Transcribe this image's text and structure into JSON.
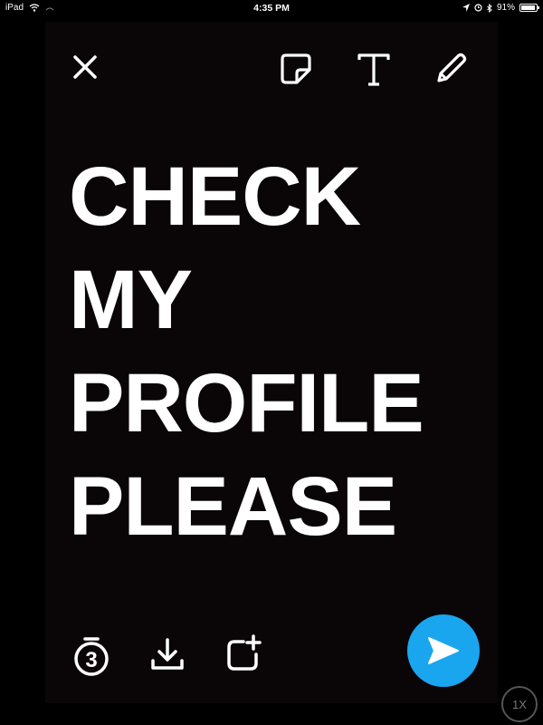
{
  "status_bar": {
    "device": "iPad",
    "time": "4:35 PM",
    "battery_text": "91%",
    "battery_level": 0.91,
    "icons": [
      "wifi-icon",
      "location-icon",
      "alarm-icon",
      "bluetooth-icon",
      "battery-icon"
    ]
  },
  "toolbar": {
    "icons": [
      "close-icon",
      "sticker-icon",
      "text-icon",
      "pencil-icon"
    ]
  },
  "caption": {
    "lines": [
      "CHECK",
      "MY",
      "PROFILE",
      "PLEASE"
    ]
  },
  "bottom_bar": {
    "timer_value": "3",
    "icons": [
      "timer-icon",
      "download-icon",
      "add-to-story-icon"
    ]
  },
  "send": {
    "icon": "send-arrow-icon",
    "color": "#1aa6ee"
  },
  "zoom": {
    "label": "1X"
  },
  "colors": {
    "background": "#000000",
    "text": "#ffffff",
    "accent": "#1aa6ee"
  }
}
